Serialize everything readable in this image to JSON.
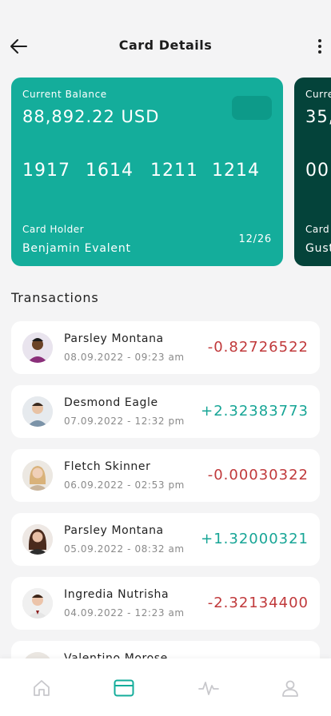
{
  "header": {
    "title": "Card Details"
  },
  "cards": [
    {
      "balance_label": "Current Balance",
      "balance": "88,892.22 USD",
      "number_groups": [
        "1917",
        "1614",
        "1211",
        "1214"
      ],
      "holder_label": "Card Holder",
      "holder": "Benjamin Evalent",
      "expiry": "12/26",
      "color": "#14ad9b"
    },
    {
      "balance_label": "Curre",
      "balance": "35,",
      "number_groups": [
        "00"
      ],
      "holder_label": "Card",
      "holder": "Gust",
      "color": "#04433a"
    }
  ],
  "transactions_title": "Transactions",
  "transactions": [
    {
      "name": "Parsley Montana",
      "date": "08.09.2022 - 09:23 am",
      "amount": "-0.82726522",
      "type": "negative"
    },
    {
      "name": "Desmond Eagle",
      "date": "07.09.2022 - 12:32 pm",
      "amount": "+2.32383773",
      "type": "positive"
    },
    {
      "name": "Fletch Skinner",
      "date": "06.09.2022 - 02:53 pm",
      "amount": "-0.00030322",
      "type": "negative"
    },
    {
      "name": "Parsley Montana",
      "date": "05.09.2022 - 08:32 am",
      "amount": "+1.32000321",
      "type": "positive"
    },
    {
      "name": "Ingredia Nutrisha",
      "date": "04.09.2022 - 12:23 am",
      "amount": "-2.32134400",
      "type": "negative"
    },
    {
      "name": "Valentino Morose",
      "date": "",
      "amount": "",
      "type": "negative"
    }
  ],
  "tabbar": {
    "items": [
      {
        "icon": "home-icon",
        "active": false
      },
      {
        "icon": "card-icon",
        "active": true
      },
      {
        "icon": "activity-icon",
        "active": false
      },
      {
        "icon": "user-icon",
        "active": false
      }
    ]
  },
  "colors": {
    "accent": "#14ad9b",
    "negative": "#c0393b",
    "positive": "#17a596"
  }
}
